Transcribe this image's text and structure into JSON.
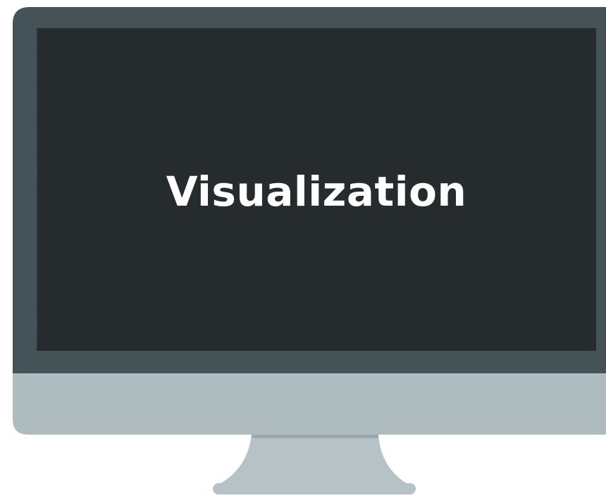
{
  "screen": {
    "title": "Visualization"
  },
  "colors": {
    "bezel": "#455258",
    "screen": "#262b2e",
    "chin": "#aebbbf",
    "stand": "#b6c2c6",
    "stand_shadow": "#9aa8ad",
    "text": "#ffffff"
  },
  "icons": {
    "device": "desktop-monitor-icon"
  }
}
